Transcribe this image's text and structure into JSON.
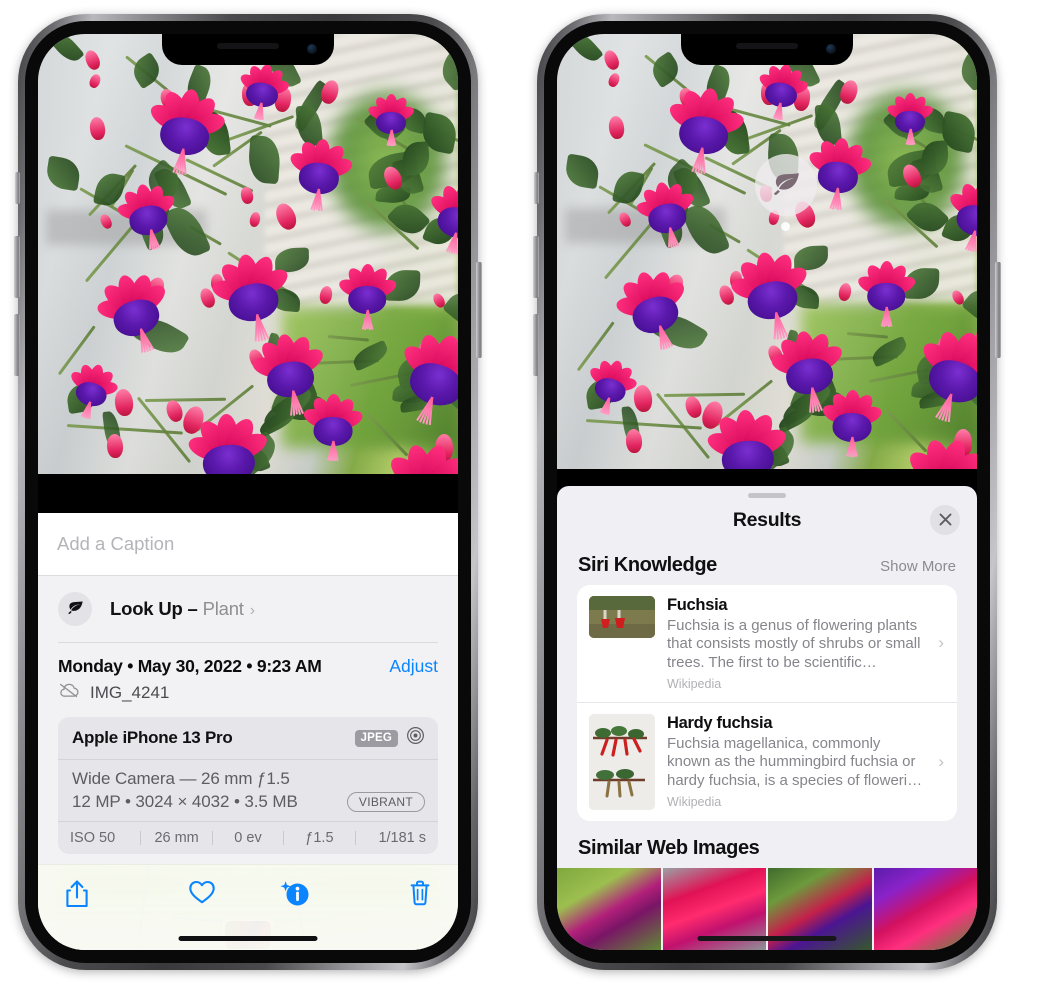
{
  "left_phone": {
    "name": "photos-detail-view",
    "caption": {
      "placeholder": "Add a Caption",
      "value": ""
    },
    "lookup": {
      "icon": "leaf-icon",
      "label": "Look Up",
      "dash": "–",
      "subject": "Plant",
      "chevron": "›"
    },
    "meta": {
      "datetime": "Monday • May 30, 2022 • 9:23 AM",
      "adjust_label": "Adjust",
      "cloud_icon": "icloud-slash-icon",
      "filename": "IMG_4241"
    },
    "exif": {
      "device": "Apple iPhone 13 Pro",
      "format_badge": "JPEG",
      "aperture_icon": "aperture-icon",
      "lens": "Wide Camera — 26 mm ƒ1.5",
      "specs": "12 MP • 3024 × 4032 • 3.5 MB",
      "style_badge": "VIBRANT",
      "settings": [
        "ISO 50",
        "26 mm",
        "0 ev",
        "ƒ1.5",
        "1/181 s"
      ]
    },
    "toolbar": [
      {
        "name": "share-button",
        "icon": "share-icon"
      },
      {
        "name": "favorite-button",
        "icon": "heart-icon"
      },
      {
        "name": "info-button",
        "icon": "info-sparkle-icon"
      },
      {
        "name": "delete-button",
        "icon": "trash-icon"
      }
    ],
    "accent_color": "#0a84ff"
  },
  "right_phone": {
    "name": "visual-look-up-results",
    "badge": {
      "icon": "leaf-icon",
      "label": "visual-look-up-badge"
    },
    "sheet": {
      "title": "Results",
      "close_icon": "close-icon",
      "grabber": "drag-handle"
    },
    "siri_knowledge": {
      "heading": "Siri Knowledge",
      "show_more": "Show More",
      "entries": [
        {
          "title": "Fuchsia",
          "description": "Fuchsia is a genus of flowering plants that consists mostly of shrubs or small trees. The first to be scientific…",
          "source": "Wikipedia",
          "chevron": "›"
        },
        {
          "title": "Hardy fuchsia",
          "description": "Fuchsia magellanica, commonly known as the hummingbird fuchsia or hardy fuchsia, is a species of floweri…",
          "source": "Wikipedia",
          "chevron": "›"
        }
      ]
    },
    "similar_web_images": {
      "heading": "Similar Web Images",
      "count": 4
    }
  }
}
